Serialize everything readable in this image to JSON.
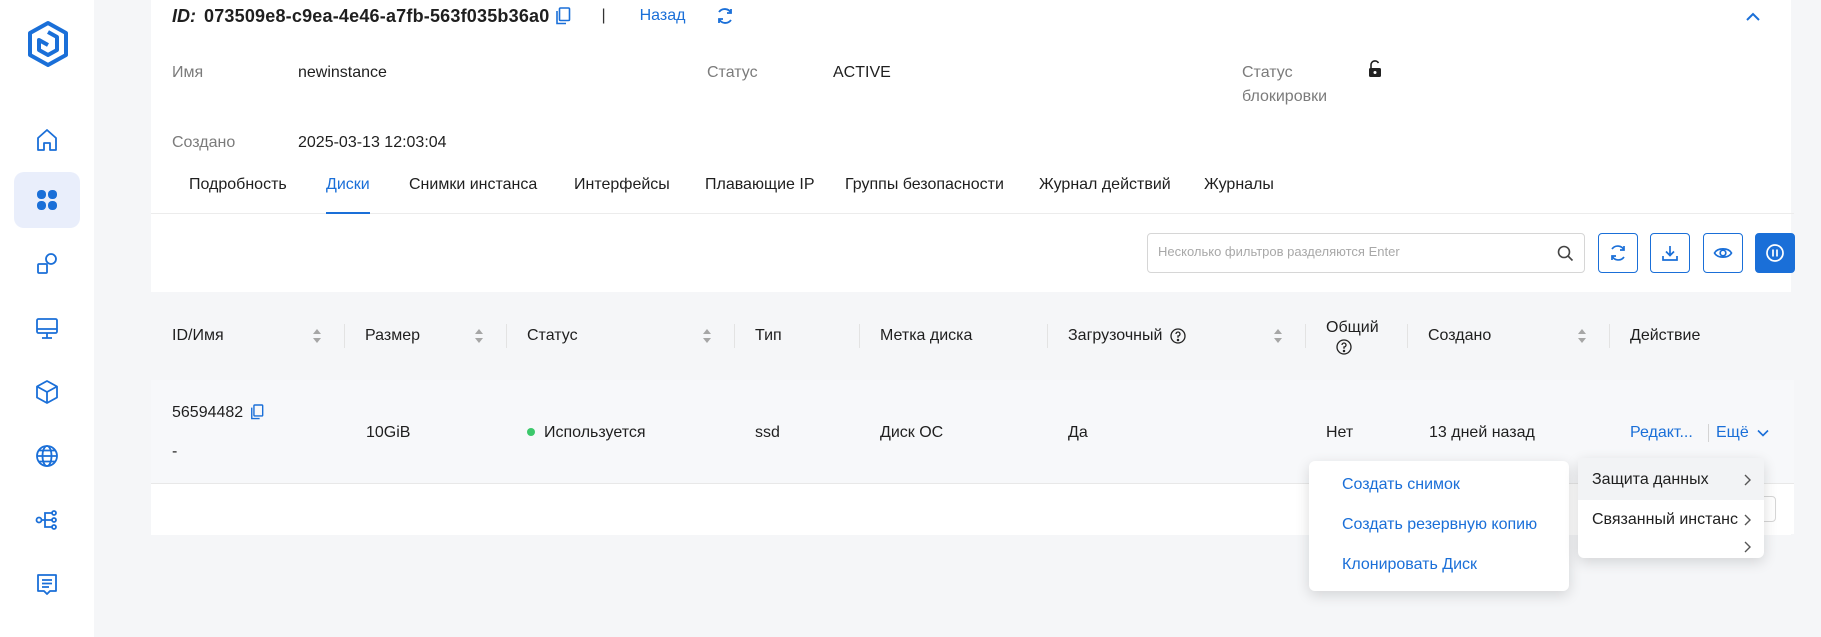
{
  "header": {
    "id_label": "ID:",
    "id_value": "073509e8-c9ea-4e46-a7fb-563f035b36a0",
    "separator": "|",
    "back_label": "Назад"
  },
  "info": {
    "name_label": "Имя",
    "name_value": "newinstance",
    "status_label": "Статус",
    "status_value": "ACTIVE",
    "lock_label": "Статус блокировки",
    "created_label": "Создано",
    "created_value": "2025-03-13 12:03:04"
  },
  "tabs": [
    "Подробность",
    "Диски",
    "Снимки инстанса",
    "Интерфейсы",
    "Плавающие IP",
    "Группы безопасности",
    "Журнал действий",
    "Журналы"
  ],
  "active_tab": "Диски",
  "search": {
    "placeholder": "Несколько фильтров разделяются Enter"
  },
  "table": {
    "columns": [
      "ID/Имя",
      "Размер",
      "Статус",
      "Тип",
      "Метка диска",
      "Загрузочный",
      "Общий",
      "Создано",
      "Действие"
    ],
    "rows": [
      {
        "id": "56594482",
        "name": "-",
        "size": "10GiB",
        "status": "Используется",
        "type": "ssd",
        "label": "Диск ОС",
        "bootable": "Да",
        "shared": "Нет",
        "created": "13 дней назад",
        "edit_label": "Редакт...",
        "more_label": "Ещё"
      }
    ]
  },
  "more_menu": {
    "items": [
      "Защита данных",
      "Связанный инстанс"
    ]
  },
  "submenu": {
    "items": [
      "Создать снимок",
      "Создать резервную копию",
      "Клонировать Диск"
    ]
  },
  "colors": {
    "accent": "#1a6fd8",
    "status_active": "#3cc86b",
    "sidebar_active_bg": "#e9eefb"
  },
  "icons": {
    "sidebar": [
      "home-icon",
      "dashboard-grid-icon",
      "shapes-icon",
      "monitor-icon",
      "cube-icon",
      "globe-icon",
      "network-tree-icon",
      "document-icon"
    ]
  }
}
